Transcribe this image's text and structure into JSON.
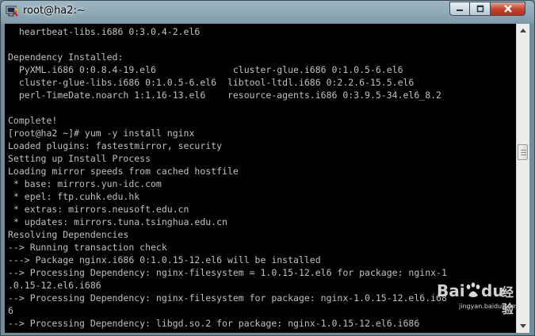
{
  "window": {
    "title": "root@ha2:~",
    "controls": {
      "minimize": "minimize",
      "maximize": "maximize",
      "close": "close"
    },
    "colors": {
      "terminal_background": "#000000",
      "terminal_text": "#c0c0c0"
    }
  },
  "terminal": {
    "lines": [
      "  heartbeat-libs.i686 0:3.0.4-2.el6",
      "",
      "Dependency Installed:",
      "  PyXML.i686 0:0.8.4-19.el6              cluster-glue.i686 0:1.0.5-6.el6",
      "  cluster-glue-libs.i686 0:1.0.5-6.el6  libtool-ltdl.i686 0:2.2.6-15.5.el6",
      "  perl-TimeDate.noarch 1:1.16-13.el6    resource-agents.i686 0:3.9.5-34.el6_8.2",
      "",
      "Complete!",
      "[root@ha2 ~]# yum -y install nginx",
      "Loaded plugins: fastestmirror, security",
      "Setting up Install Process",
      "Loading mirror speeds from cached hostfile",
      " * base: mirrors.yun-idc.com",
      " * epel: ftp.cuhk.edu.hk",
      " * extras: mirrors.neusoft.edu.cn",
      " * updates: mirrors.tuna.tsinghua.edu.cn",
      "Resolving Dependencies",
      "--> Running transaction check",
      "---> Package nginx.i686 0:1.0.15-12.el6 will be installed",
      "--> Processing Dependency: nginx-filesystem = 1.0.15-12.el6 for package: nginx-1",
      ".0.15-12.el6.i686",
      "--> Processing Dependency: nginx-filesystem for package: nginx-1.0.15-12.el6.i68",
      "6",
      "--> Processing Dependency: libgd.so.2 for package: nginx-1.0.15-12.el6.i686"
    ]
  },
  "watermark": {
    "brand": "Bai",
    "brand_suffix": "du",
    "suffix": "经验",
    "url": "jingyan.baidu.com"
  }
}
